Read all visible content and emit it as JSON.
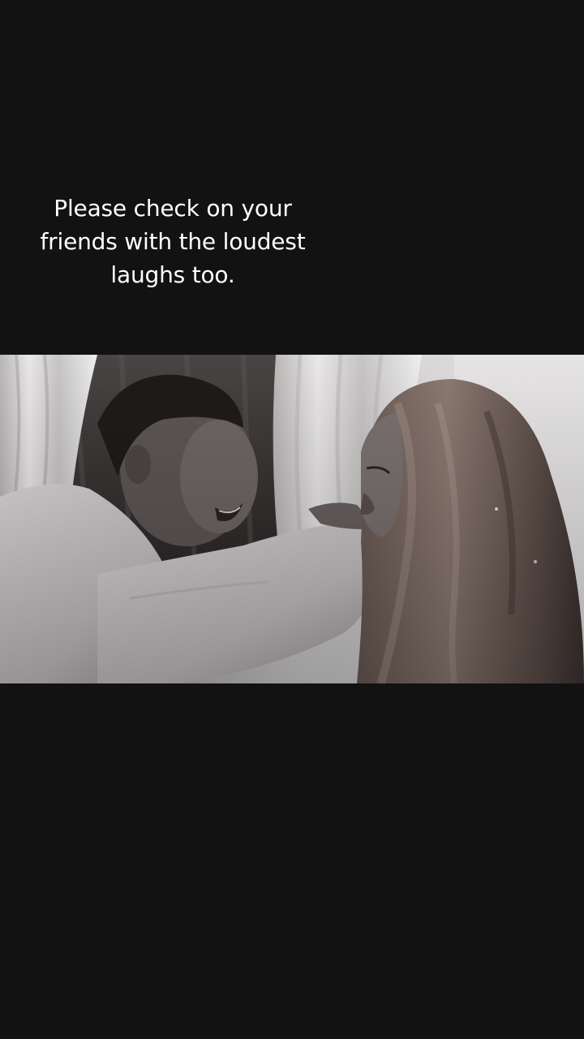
{
  "caption": {
    "text": "Please check on your\nfriends with the loudest\nlaughs too."
  },
  "video": {
    "icon": "video-frame"
  },
  "colors": {
    "background": "#121212",
    "caption_text": "#ffffff"
  }
}
